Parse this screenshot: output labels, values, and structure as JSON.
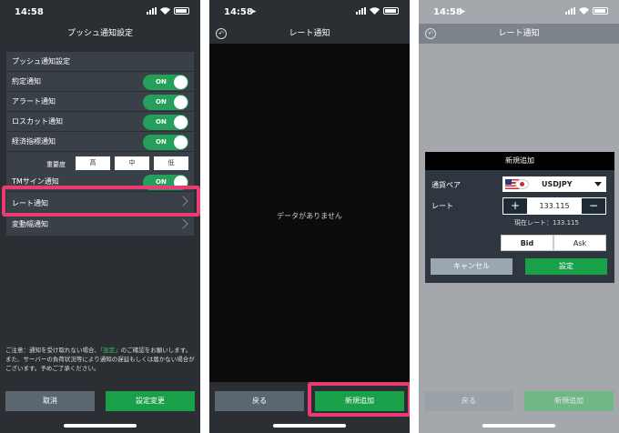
{
  "time": "14:58",
  "screen1": {
    "title": "プッシュ通知設定",
    "section_header": "プッシュ通知設定",
    "toggle_on": "ON",
    "items": [
      {
        "label": "約定通知"
      },
      {
        "label": "アラート通知"
      },
      {
        "label": "ロスカット通知"
      },
      {
        "label": "経済指標通知"
      }
    ],
    "importance_label": "重要度",
    "importance_options": [
      "高",
      "中",
      "低"
    ],
    "tm_sign": "TMサイン通知",
    "rate_notify": "レート通知",
    "change_notify": "変動幅通知",
    "note_1": "ご注意：通知を受け取れない場合、",
    "note_link": "「設定」",
    "note_2": "のご確認をお願いします。",
    "note_3": "また、サーバーの負荷状況等により通知の遅延もしくは届かない場合がございます。予めご了承ください。",
    "cancel_button": "取消",
    "apply_button": "設定変更"
  },
  "screen2": {
    "title": "レート通知",
    "empty_message": "データがありません",
    "back_button": "戻る",
    "add_button": "新規追加"
  },
  "screen3": {
    "title": "レート通知",
    "back_button": "戻る",
    "add_button": "新規追加",
    "modal": {
      "title": "新規追加",
      "pair_label": "通貨ペア",
      "pair_value": "USDJPY",
      "rate_label": "レート",
      "plus": "+",
      "minus": "−",
      "rate_value": "133.115",
      "current_rate": "現在レート：133.115",
      "bid": "Bid",
      "ask": "Ask",
      "cancel": "キャンセル",
      "confirm": "設定"
    }
  },
  "colors": {
    "background": "#2b2f33",
    "accent_green": "#1aa049",
    "highlight_pink": "#e93c72",
    "button_gray": "#5b6770"
  }
}
